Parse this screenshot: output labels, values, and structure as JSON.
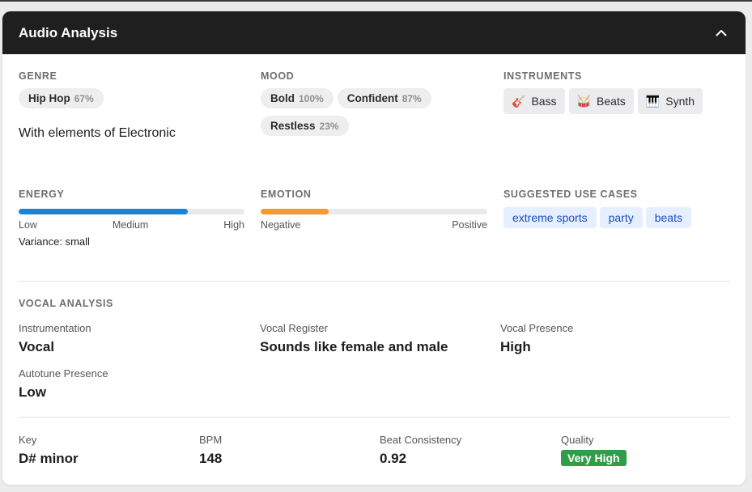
{
  "header": {
    "title": "Audio Analysis",
    "collapse_icon": "chevron-up-icon"
  },
  "genre": {
    "label": "GENRE",
    "items": [
      {
        "name": "Hip Hop",
        "pct": "67%"
      }
    ],
    "elements_text": "With elements of Electronic"
  },
  "mood": {
    "label": "MOOD",
    "items": [
      {
        "name": "Bold",
        "pct": "100%"
      },
      {
        "name": "Confident",
        "pct": "87%"
      },
      {
        "name": "Restless",
        "pct": "23%"
      }
    ]
  },
  "instruments": {
    "label": "INSTRUMENTS",
    "items": [
      {
        "icon": "🎸",
        "icon_name": "guitar-icon",
        "name": "Bass"
      },
      {
        "icon": "🥁",
        "icon_name": "drum-icon",
        "name": "Beats"
      },
      {
        "icon": "🎹",
        "icon_name": "keyboard-icon",
        "name": "Synth"
      }
    ]
  },
  "energy": {
    "label": "ENERGY",
    "level": 0.75,
    "color": "#1a84d8",
    "scale": [
      "Low",
      "Medium",
      "High"
    ],
    "variance": "Variance: small"
  },
  "emotion": {
    "label": "EMOTION",
    "level": 0.3,
    "color": "#f59a2e",
    "scale": [
      "Negative",
      "Positive"
    ]
  },
  "use_cases": {
    "label": "SUGGESTED USE CASES",
    "items": [
      "extreme sports",
      "party",
      "beats"
    ]
  },
  "vocal": {
    "label": "VOCAL ANALYSIS",
    "instrumentation": {
      "k": "Instrumentation",
      "v": "Vocal"
    },
    "register": {
      "k": "Vocal Register",
      "v": "Sounds like female and male"
    },
    "presence": {
      "k": "Vocal Presence",
      "v": "High"
    },
    "autotune": {
      "k": "Autotune Presence",
      "v": "Low"
    }
  },
  "stats": {
    "key": {
      "k": "Key",
      "v": "D# minor"
    },
    "bpm": {
      "k": "BPM",
      "v": "148"
    },
    "beat": {
      "k": "Beat Consistency",
      "v": "0.92"
    },
    "quality": {
      "k": "Quality",
      "v": "Very High",
      "color": "#2f9e47"
    }
  }
}
